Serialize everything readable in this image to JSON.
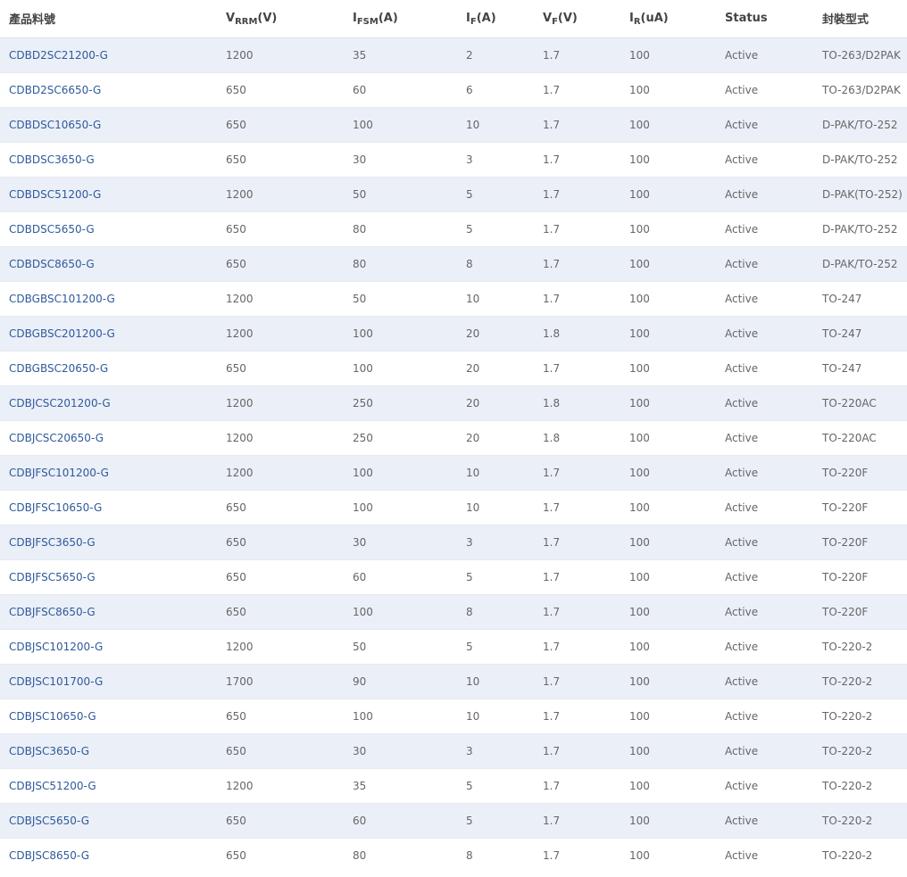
{
  "table": {
    "headers": [
      {
        "main": "產品料號",
        "sub": "",
        "tail": ""
      },
      {
        "main": "V",
        "sub": "RRM",
        "tail": "(V)"
      },
      {
        "main": "I",
        "sub": "FSM",
        "tail": "(A)"
      },
      {
        "main": "I",
        "sub": "F",
        "tail": "(A)"
      },
      {
        "main": "V",
        "sub": "F",
        "tail": "(V)"
      },
      {
        "main": "I",
        "sub": "R",
        "tail": "(uA)"
      },
      {
        "main": "Status",
        "sub": "",
        "tail": ""
      },
      {
        "main": "封裝型式",
        "sub": "",
        "tail": ""
      }
    ],
    "rows": [
      [
        "CDBD2SC21200-G",
        "1200",
        "35",
        "2",
        "1.7",
        "100",
        "Active",
        "TO-263/D2PAK"
      ],
      [
        "CDBD2SC6650-G",
        "650",
        "60",
        "6",
        "1.7",
        "100",
        "Active",
        "TO-263/D2PAK"
      ],
      [
        "CDBDSC10650-G",
        "650",
        "100",
        "10",
        "1.7",
        "100",
        "Active",
        "D-PAK/TO-252"
      ],
      [
        "CDBDSC3650-G",
        "650",
        "30",
        "3",
        "1.7",
        "100",
        "Active",
        "D-PAK/TO-252"
      ],
      [
        "CDBDSC51200-G",
        "1200",
        "50",
        "5",
        "1.7",
        "100",
        "Active",
        "D-PAK(TO-252)"
      ],
      [
        "CDBDSC5650-G",
        "650",
        "80",
        "5",
        "1.7",
        "100",
        "Active",
        "D-PAK/TO-252"
      ],
      [
        "CDBDSC8650-G",
        "650",
        "80",
        "8",
        "1.7",
        "100",
        "Active",
        "D-PAK/TO-252"
      ],
      [
        "CDBGBSC101200-G",
        "1200",
        "50",
        "10",
        "1.7",
        "100",
        "Active",
        "TO-247"
      ],
      [
        "CDBGBSC201200-G",
        "1200",
        "100",
        "20",
        "1.8",
        "100",
        "Active",
        "TO-247"
      ],
      [
        "CDBGBSC20650-G",
        "650",
        "100",
        "20",
        "1.7",
        "100",
        "Active",
        "TO-247"
      ],
      [
        "CDBJCSC201200-G",
        "1200",
        "250",
        "20",
        "1.8",
        "100",
        "Active",
        "TO-220AC"
      ],
      [
        "CDBJCSC20650-G",
        "1200",
        "250",
        "20",
        "1.8",
        "100",
        "Active",
        "TO-220AC"
      ],
      [
        "CDBJFSC101200-G",
        "1200",
        "100",
        "10",
        "1.7",
        "100",
        "Active",
        "TO-220F"
      ],
      [
        "CDBJFSC10650-G",
        "650",
        "100",
        "10",
        "1.7",
        "100",
        "Active",
        "TO-220F"
      ],
      [
        "CDBJFSC3650-G",
        "650",
        "30",
        "3",
        "1.7",
        "100",
        "Active",
        "TO-220F"
      ],
      [
        "CDBJFSC5650-G",
        "650",
        "60",
        "5",
        "1.7",
        "100",
        "Active",
        "TO-220F"
      ],
      [
        "CDBJFSC8650-G",
        "650",
        "100",
        "8",
        "1.7",
        "100",
        "Active",
        "TO-220F"
      ],
      [
        "CDBJSC101200-G",
        "1200",
        "50",
        "5",
        "1.7",
        "100",
        "Active",
        "TO-220-2"
      ],
      [
        "CDBJSC101700-G",
        "1700",
        "90",
        "10",
        "1.7",
        "100",
        "Active",
        "TO-220-2"
      ],
      [
        "CDBJSC10650-G",
        "650",
        "100",
        "10",
        "1.7",
        "100",
        "Active",
        "TO-220-2"
      ],
      [
        "CDBJSC3650-G",
        "650",
        "30",
        "3",
        "1.7",
        "100",
        "Active",
        "TO-220-2"
      ],
      [
        "CDBJSC51200-G",
        "1200",
        "35",
        "5",
        "1.7",
        "100",
        "Active",
        "TO-220-2"
      ],
      [
        "CDBJSC5650-G",
        "650",
        "60",
        "5",
        "1.7",
        "100",
        "Active",
        "TO-220-2"
      ],
      [
        "CDBJSC8650-G",
        "650",
        "80",
        "8",
        "1.7",
        "100",
        "Active",
        "TO-220-2"
      ]
    ]
  },
  "colors": {
    "link": "#2e5a9b",
    "stripe": "#ebeff8",
    "text": "#666666",
    "header_text": "#444444"
  }
}
